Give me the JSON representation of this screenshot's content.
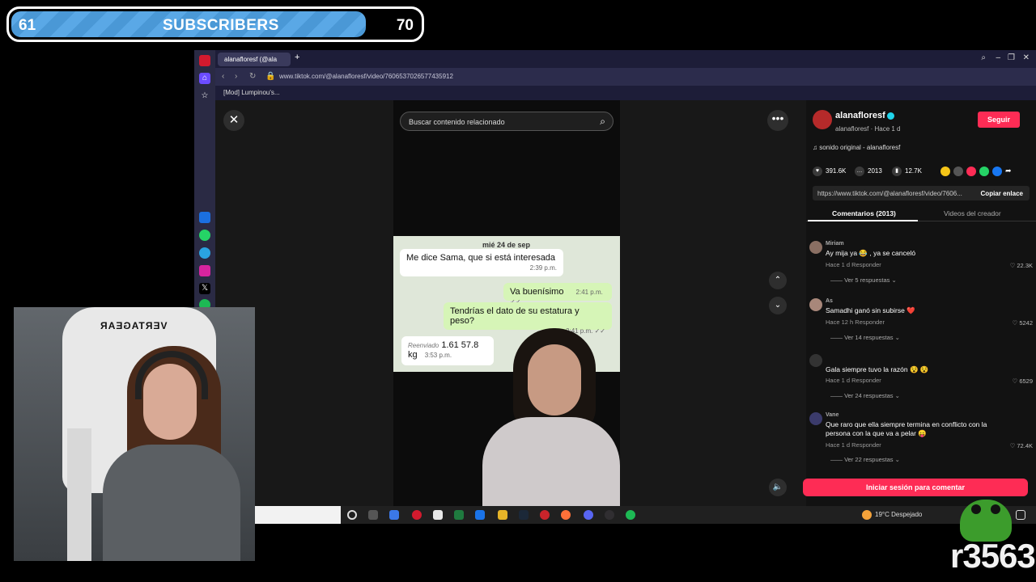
{
  "overlay": {
    "subs_current": "61",
    "subs_label": "SUBSCRIBERS",
    "subs_goal": "70",
    "fill_fraction": 0.87
  },
  "browser": {
    "tab_title": "alanafloresf (@ala",
    "url": "www.tiktok.com/@alanafloresf/video/7606537026577435912",
    "bookmark": "[Mod] Lumpinou's...",
    "icons": [
      "opera-icon",
      "home-icon",
      "star-icon",
      "messenger-icon",
      "whatsapp-icon",
      "telegram-icon",
      "instagram-icon",
      "x-icon",
      "spotify-icon"
    ]
  },
  "tiktok": {
    "search_placeholder": "Buscar contenido relacionado",
    "chat": {
      "date": "mié 24 de sep",
      "m1_text": "Me dice Sama, que si está interesada",
      "m1_time": "2:39 p.m.",
      "m2_text": "Va buenísimo",
      "m2_time": "2:41 p.m. ✓✓",
      "m3_text": "Tendrías el dato de su estatura y peso?",
      "m3_time": "2:41 p.m. ✓✓",
      "m4_fwd": "Reenviado",
      "m4_text": "1.61 57.8 kg",
      "m4_time": "3:53 p.m."
    },
    "author": {
      "name": "alanafloresf",
      "sub": "alanafloresf · Hace 1 d",
      "follow": "Seguir",
      "sound": "sonido original - alanafloresf"
    },
    "stats": {
      "likes": "391.6K",
      "comments": "2013",
      "saves": "12.7K"
    },
    "link": {
      "url": "https://www.tiktok.com/@alanafloresf/video/7606...",
      "copy": "Copiar enlace"
    },
    "tabs": {
      "comments": "Comentarios (2013)",
      "videos": "Videos del creador"
    },
    "comments": [
      {
        "user": "Miriam",
        "text": "Ay mija ya 😂 , ya se canceló",
        "meta": "Hace 1 d   Responder",
        "likes": "22.3K",
        "replies": "Ver 5 respuestas ⌄"
      },
      {
        "user": "As",
        "text": "Samadhi ganó sin subirse ❤️",
        "meta": "Hace 12 h   Responder",
        "likes": "5242",
        "replies": "Ver 14 respuestas ⌄"
      },
      {
        "user": "",
        "text": "Gala siempre tuvo la razón 😵 😵",
        "meta": "Hace 1 d   Responder",
        "likes": "6529",
        "replies": "Ver 24 respuestas ⌄"
      },
      {
        "user": "Vane",
        "text": "Que raro que ella siempre termina en conflicto con la persona con la que va a pelar 😛",
        "meta": "Hace 1 d   Responder",
        "likes": "72.4K",
        "replies": "Ver 22 respuestas ⌄"
      }
    ],
    "login": "Iniciar sesión para comentar"
  },
  "taskbar": {
    "weather": "19°C  Despejado"
  },
  "webcam": {
    "chair_logo": "VERTAGEAR"
  },
  "corner_tag": "r3563"
}
